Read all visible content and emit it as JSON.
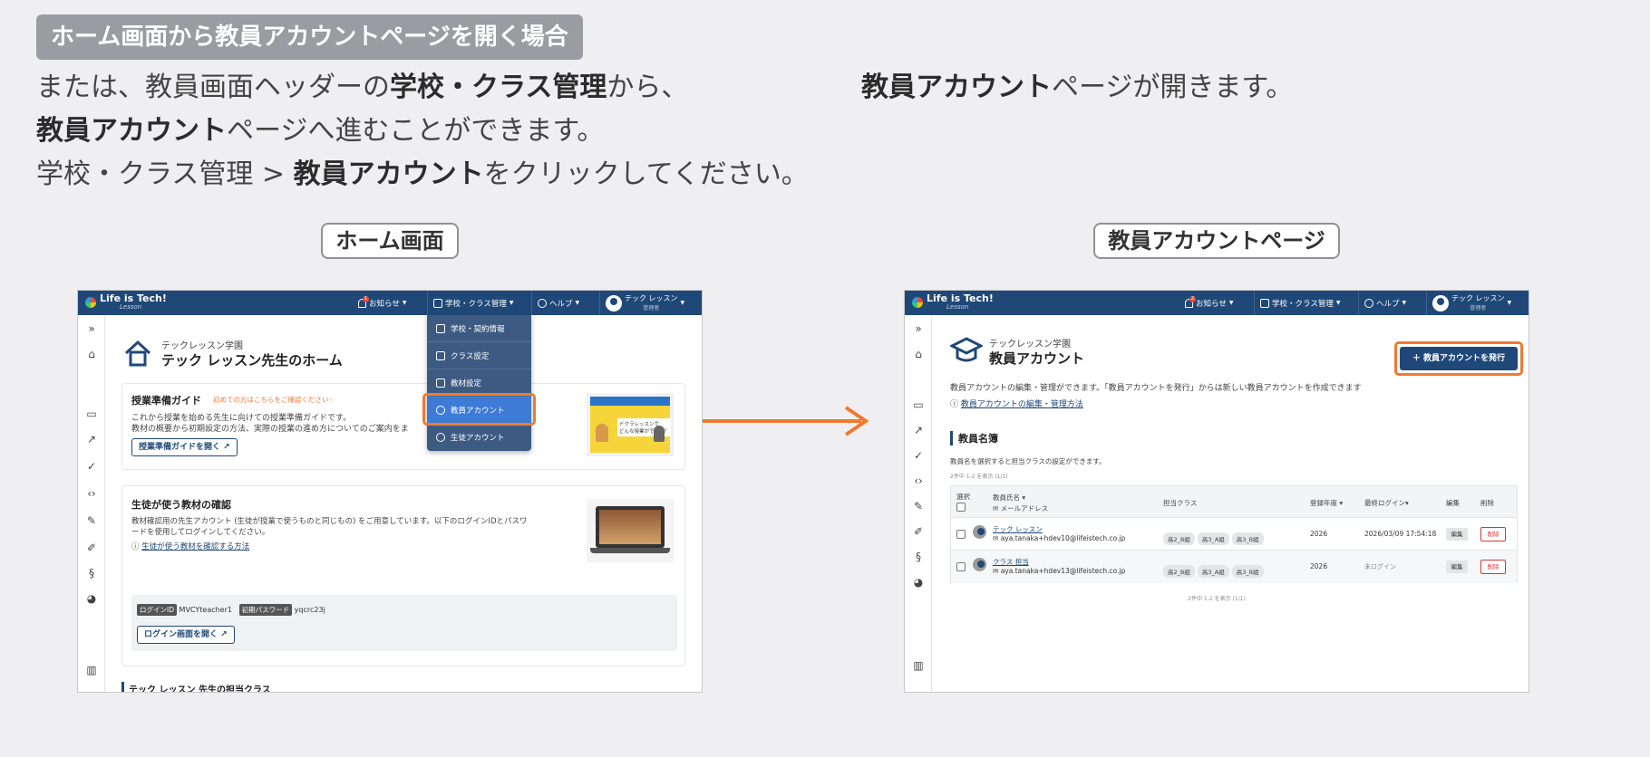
{
  "header_badge": "ホーム画面から教員アカウントページを開く場合",
  "intro_left": {
    "line1_prefix": "または、教員画面ヘッダーの",
    "line1_bold": "学校・クラス管理",
    "line1_suffix": "から、",
    "line2_bold": "教員アカウント",
    "line2_suffix": "ページへ進むことができます。",
    "line3_prefix": "学校・クラス管理 > ",
    "line3_bold": "教員アカウント",
    "line3_suffix": "をクリックしてください。"
  },
  "intro_right": {
    "bold": "教員アカウント",
    "suffix": "ページが開きます。"
  },
  "captions": {
    "home": "ホーム画面",
    "teacher_page": "教員アカウントページ"
  },
  "colors": {
    "header_navy": "#1f4878",
    "highlight_orange": "#ee7a33",
    "active_blue": "#3e7bd6"
  },
  "app": {
    "logo": "Life is Tech!",
    "logo_sub": "Lesson",
    "nav": {
      "notifications": "お知らせ",
      "school_class": "学校・クラス管理",
      "help": "ヘルプ",
      "user_name": "テック レッスン",
      "user_role": "管理者"
    },
    "sidebar_icons": [
      "expand-icon",
      "home-icon",
      "terminal-icon",
      "chart-line-icon",
      "check-circle-icon",
      "code-icon",
      "pen-icon",
      "edit-icon",
      "python-icon",
      "palette-icon",
      "bar-chart-icon"
    ]
  },
  "home": {
    "school": "テックレッスン学園",
    "title": "テック レッスン先生のホーム",
    "dropdown": [
      "学校・契約情報",
      "クラス設定",
      "教材設定",
      "教員アカウント",
      "生徒アカウント"
    ],
    "guide": {
      "title": "授業準備ガイド",
      "note": "初めての方はこちらをご確認ください☝",
      "desc1": "これから授業を始める先生に向けての授業準備ガイドです。",
      "desc2": "教材の概要から初期設定の方法、実際の授業の進め方についてのご案内をま",
      "button": "授業準備ガイドを開く",
      "thumb_text": "ドクラレッスンで\nどんな授業ができる？"
    },
    "materials": {
      "title": "生徒が使う教材の確認",
      "desc1": "教材確認用の先生アカウント (生徒が授業で使うものと同じもの) をご用意しています。以下のログインIDとパスワ",
      "desc2": "ードを使用してログインしてください。",
      "link": "生徒が使う教材を確認する方法",
      "login_id_label": "ログインID",
      "login_id": "MVCYteacher1",
      "password_label": "初期パスワード",
      "password": "yqcrc23j",
      "login_button": "ログイン画面を開く"
    },
    "classes_heading": "テック レッスン 先生の担当クラス"
  },
  "teacher": {
    "school": "テックレッスン学園",
    "title": "教員アカウント",
    "issue_button": "＋ 教員アカウントを発行",
    "desc": "教員アカウントの編集・管理ができます。「教員アカウントを発行」からは新しい教員アカウントを作成できます",
    "help_link": "教員アカウントの編集・管理方法",
    "roster_heading": "教員名簿",
    "roster_desc": "教員名を選択すると担当クラスの設定ができます。",
    "count_top": "2件中 1-2 を表示 (1/1)",
    "count_bottom": "2件中 1-2 を表示 (1/1)",
    "columns": {
      "select": "選択",
      "name": "教員氏名",
      "email": "メールアドレス",
      "classes": "担当クラス",
      "year": "登録年度",
      "last_login": "最終ログイン",
      "edit": "編集",
      "delete": "削除"
    },
    "rows": [
      {
        "name": "テック レッスン",
        "email": "aya.tanaka+hdev10@lifeistech.co.jp",
        "classes": [
          "高2_B組",
          "高3_A組",
          "高3_B組"
        ],
        "year": "2026",
        "last_login": "2026/03/09 17:54:18",
        "edit": "編集",
        "delete": "削除"
      },
      {
        "name": "クラス 担当",
        "email": "aya.tanaka+hdev13@lifeistech.co.jp",
        "classes": [
          "高2_B組",
          "高3_A組",
          "高3_B組"
        ],
        "year": "2026",
        "last_login": "未ログイン",
        "edit": "編集",
        "delete": "削除"
      }
    ]
  }
}
